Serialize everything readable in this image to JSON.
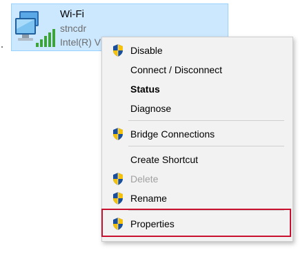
{
  "adapter": {
    "name": "Wi-Fi",
    "ssid": "stncdr",
    "driver": "Intel(R) V"
  },
  "menu": {
    "items": [
      {
        "label": "Disable",
        "icon": "uac-shield-icon"
      },
      {
        "label": "Connect / Disconnect"
      },
      {
        "label": "Status",
        "bold": true
      },
      {
        "label": "Diagnose"
      },
      {
        "label": "Bridge Connections",
        "icon": "uac-shield-icon"
      },
      {
        "label": "Create Shortcut"
      },
      {
        "label": "Delete",
        "icon": "uac-shield-icon",
        "disabled": true
      },
      {
        "label": "Rename",
        "icon": "uac-shield-icon"
      },
      {
        "label": "Properties",
        "icon": "uac-shield-icon",
        "highlighted": true
      }
    ]
  },
  "colors": {
    "tile_bg": "#cce8ff",
    "menu_bg": "#f2f2f2",
    "highlight_border": "#c8102e",
    "disabled_text": "#a0a0a0"
  }
}
